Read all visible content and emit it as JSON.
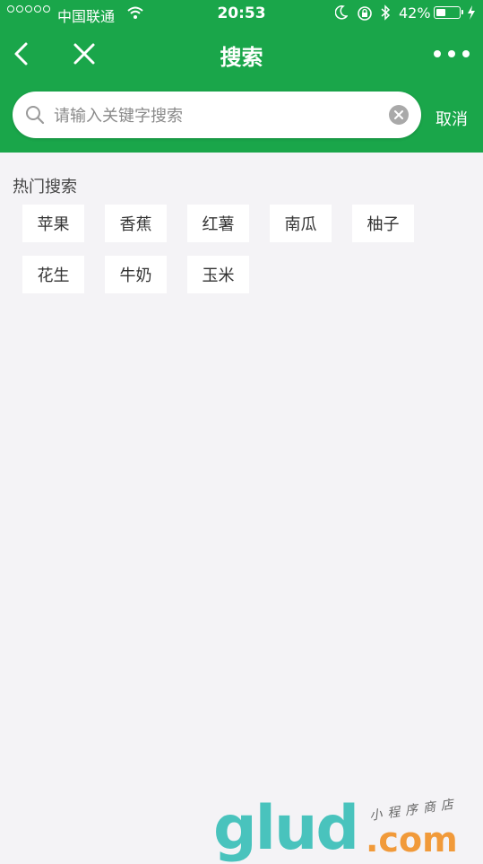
{
  "status_bar": {
    "carrier": "中国联通",
    "time": "20:53",
    "battery_percent": "42%",
    "battery_level": 0.42
  },
  "nav": {
    "title": "搜索"
  },
  "search": {
    "placeholder": "请输入关键字搜索",
    "value": "",
    "cancel_label": "取消"
  },
  "hot_search": {
    "title": "热门搜索",
    "tags": [
      "苹果",
      "香蕉",
      "红薯",
      "南瓜",
      "柚子",
      "花生",
      "牛奶",
      "玉米"
    ]
  },
  "watermark": {
    "logo": "glud",
    "domain": ".com",
    "tagline": "小程序商店"
  },
  "colors": {
    "header_green": "#1aa64a",
    "page_background": "#f4f3f6"
  }
}
